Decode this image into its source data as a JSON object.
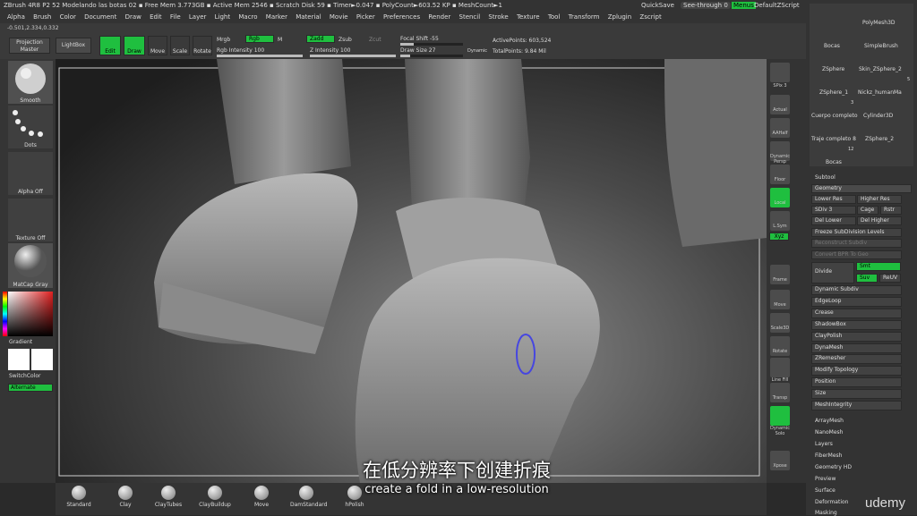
{
  "window": {
    "title": "ZBrush 4R8 P2    52 Modelando las botas 02    ▪ Free Mem 3.773GB ▪ Active Mem 2546 ▪ Scratch Disk 59 ▪ Timer►0.047 ▪ PolyCount►603.52 KP ▪ MeshCount►1",
    "quicksave": "QuickSave",
    "seethrough": "See-through",
    "seethrough_value": "0",
    "menus": "Menus",
    "script": "DefaultZScript"
  },
  "menu": [
    "Alpha",
    "Brush",
    "Color",
    "Document",
    "Draw",
    "Edit",
    "File",
    "Layer",
    "Light",
    "Macro",
    "Marker",
    "Material",
    "Movie",
    "Picker",
    "Preferences",
    "Render",
    "Stencil",
    "Stroke",
    "Texture",
    "Tool",
    "Transform",
    "Zplugin",
    "Zscript"
  ],
  "topbar": {
    "coords": "-0.501,2.334,0.332",
    "projection_master": "Projection Master",
    "lightbox": "LightBox",
    "edit": "Edit",
    "draw": "Draw",
    "move": "Move",
    "scale": "Scale",
    "rotate": "Rotate",
    "mrgb": "Mrgb",
    "rgb": "Rgb",
    "m": "M",
    "zadd": "Zadd",
    "zsub": "Zsub",
    "zcut": "Zcut",
    "rgb_intensity": "Rgb Intensity 100",
    "z_intensity": "Z Intensity 100",
    "focal_shift": "Focal Shift -55",
    "draw_size": "Draw Size 27",
    "dynamic": "Dynamic",
    "active_points": "ActivePoints: 603,524",
    "total_points": "TotalPoints: 9.84 Mil"
  },
  "leftshelf": {
    "smooth": "Smooth",
    "dots": "Dots",
    "alpha_off": "Alpha Off",
    "texture_off": "Texture Off",
    "matcap": "MatCap Gray",
    "gradient": "Gradient",
    "switch_color": "SwitchColor",
    "alternate": "Alternate"
  },
  "rightshelf": [
    "SPix 3",
    "Actual",
    "AAHalf",
    "Dynamic Persp",
    "Floor",
    "Local",
    "L.Sym",
    "Xyz",
    "Frame",
    "Move",
    "Scale3D",
    "Rotate",
    "Line Fill PolyF",
    "Transp",
    "Dynamic Solo",
    "Xpose"
  ],
  "toolpanel": {
    "thumbs": [
      {
        "label": "Bocas",
        "count": ""
      },
      {
        "label": "PolyMesh3D",
        "count": ""
      },
      {
        "label": "SimpleBrush",
        "count": ""
      },
      {
        "label": "ZSphere",
        "count": ""
      },
      {
        "label": "Skin_ZSphere_2",
        "count": ""
      },
      {
        "label": "ZSphere_1",
        "count": ""
      },
      {
        "label": "Nickz_humanMa",
        "count": "5"
      },
      {
        "label": "Cuerpo completo",
        "count": "3"
      },
      {
        "label": "Cylinder3D",
        "count": ""
      },
      {
        "label": "Traje completo 8",
        "count": ""
      },
      {
        "label": "ZSphere_2",
        "count": ""
      },
      {
        "label": "Bocas",
        "count": "12"
      }
    ],
    "subtool": "Subtool",
    "geometry": "Geometry",
    "lower_res": "Lower Res",
    "higher_res": "Higher Res",
    "sdiv": "SDiv 3",
    "cage": "Cage",
    "rstr": "Rstr",
    "del_lower": "Del Lower",
    "del_higher": "Del Higher",
    "freeze": "Freeze SubDivision Levels",
    "reconstruct": "Reconstruct Subdiv",
    "convert": "Convert BPR To Geo",
    "divide": "Divide",
    "smt": "Smt",
    "suv": "Suv",
    "reuv": "ReUV",
    "items": [
      "Dynamic Subdiv",
      "EdgeLoop",
      "Crease",
      "ShadowBox",
      "ClayPolish",
      "DynaMesh",
      "ZRemesher",
      "Modify Topology",
      "Position",
      "Size",
      "MeshIntegrity"
    ],
    "sections": [
      "ArrayMesh",
      "NanoMesh",
      "Layers",
      "FiberMesh",
      "Geometry HD",
      "Preview",
      "Surface",
      "Deformation",
      "Masking"
    ]
  },
  "brushes": [
    "Standard",
    "Clay",
    "ClayTubes",
    "ClayBuildup",
    "Move",
    "DamStandard",
    "hPolish"
  ],
  "subtitle": {
    "zh": "在低分辨率下创建折痕",
    "en": "create a fold in a low-resolution"
  },
  "watermark": "udemy"
}
